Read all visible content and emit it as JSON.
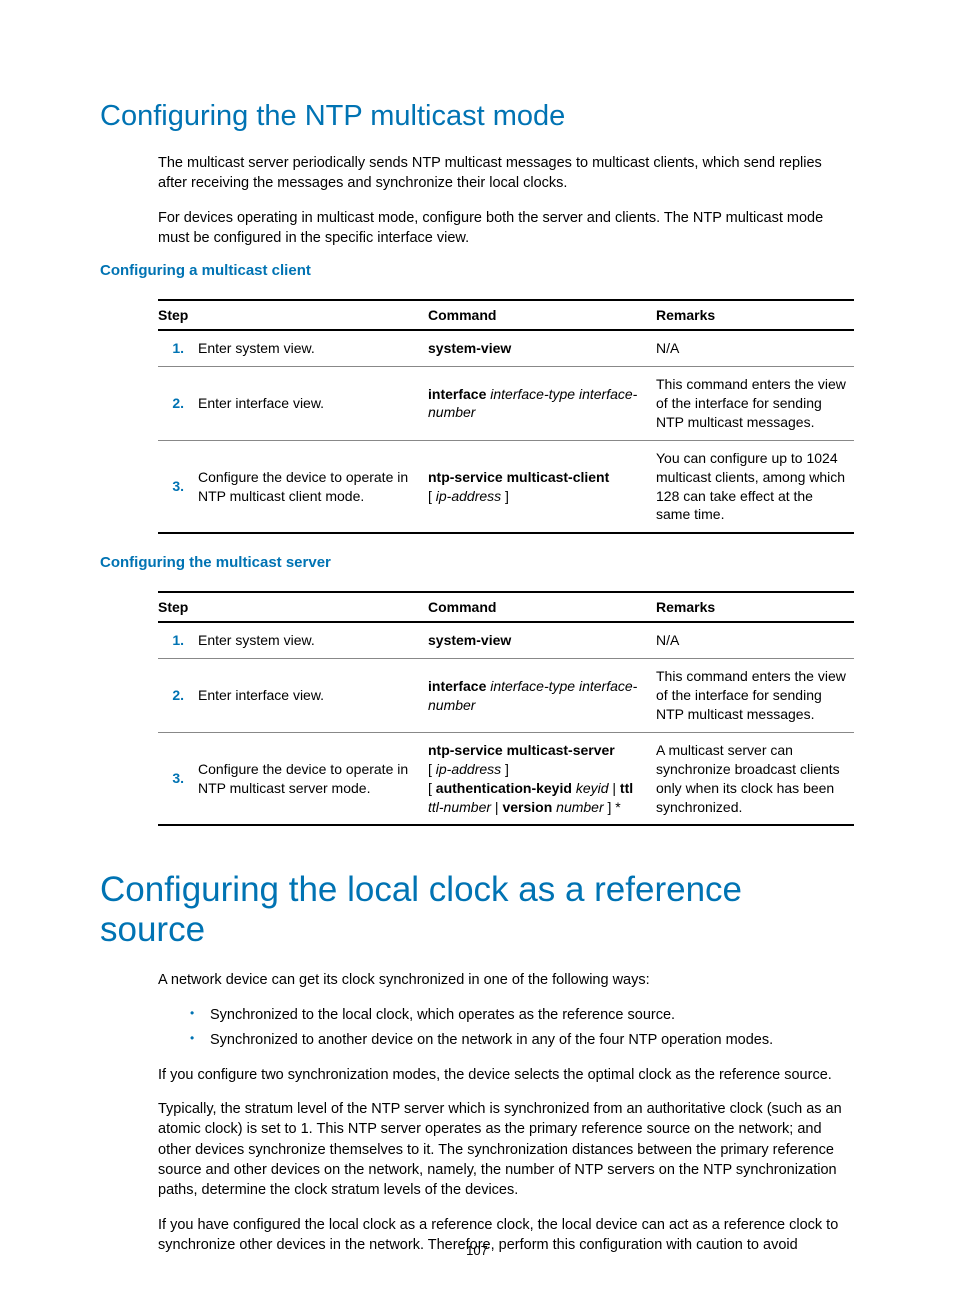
{
  "page_number": "107",
  "section1": {
    "title": "Configuring the NTP multicast mode",
    "para1": "The multicast server periodically sends NTP multicast messages to multicast clients, which send replies after receiving the messages and synchronize their local clocks.",
    "para2": "For devices operating in multicast mode, configure both the server and clients. The NTP multicast mode must be configured in the specific interface view.",
    "sub1_title": "Configuring a multicast client",
    "sub2_title": "Configuring the multicast server"
  },
  "table_headers": {
    "step": "Step",
    "command": "Command",
    "remarks": "Remarks"
  },
  "table1": {
    "r1": {
      "num": "1.",
      "step": "Enter system view.",
      "cmd_b1": "system-view",
      "remarks": "N/A"
    },
    "r2": {
      "num": "2.",
      "step": "Enter interface view.",
      "cmd_b1": "interface",
      "cmd_i1": "interface-type interface-number",
      "remarks": "This command enters the view of the interface for sending NTP multicast messages."
    },
    "r3": {
      "num": "3.",
      "step": "Configure the device to operate in NTP multicast client mode.",
      "cmd_b1": "ntp-service multicast-client",
      "cmd_brkt_l": "[ ",
      "cmd_i1": "ip-address",
      "cmd_brkt_r": " ]",
      "remarks": "You can configure up to 1024 multicast clients, among which 128 can take effect at the same time."
    }
  },
  "table2": {
    "r1": {
      "num": "1.",
      "step": "Enter system view.",
      "cmd_b1": "system-view",
      "remarks": "N/A"
    },
    "r2": {
      "num": "2.",
      "step": "Enter interface view.",
      "cmd_b1": "interface",
      "cmd_i1": "interface-type interface-number",
      "remarks": "This command enters the view of the interface for sending NTP multicast messages."
    },
    "r3": {
      "num": "3.",
      "step": "Configure the device to operate in NTP multicast server mode.",
      "cmd_b1": "ntp-service multicast-server",
      "cmd_brkt_l": "[ ",
      "cmd_i1": "ip-address",
      "cmd_brkt_r": " ]",
      "cmd_brkt_l2": "[ ",
      "cmd_b2": "authentication-keyid",
      "cmd_i2": "keyid",
      "cmd_pipe": " | ",
      "cmd_b3": "ttl",
      "cmd_i3": "ttl-number",
      "cmd_pipe2": " | ",
      "cmd_b4": "version",
      "cmd_i4": "number",
      "cmd_brkt_r2": " ] *",
      "remarks": "A multicast server can synchronize broadcast clients only when its clock has been synchronized."
    }
  },
  "section2": {
    "title": "Configuring the local clock as a reference source",
    "para1": "A network device can get its clock synchronized in one of the following ways:",
    "bullet1": "Synchronized to the local clock, which operates as the reference source.",
    "bullet2": "Synchronized to another device on the network in any of the four NTP operation modes.",
    "para2": "If you configure two synchronization modes, the device selects the optimal clock as the reference source.",
    "para3": "Typically, the stratum level of the NTP server which is synchronized from an authoritative clock (such as an atomic clock) is set to 1. This NTP server operates as the primary reference source on the network; and other devices synchronize themselves to it. The synchronization distances between the primary reference source and other devices on the network, namely, the number of NTP servers on the NTP synchronization paths, determine the clock stratum levels of the devices.",
    "para4": "If you have configured the local clock as a reference clock, the local device can act as a reference clock to synchronize other devices in the network. Therefore, perform this configuration with caution to avoid"
  }
}
